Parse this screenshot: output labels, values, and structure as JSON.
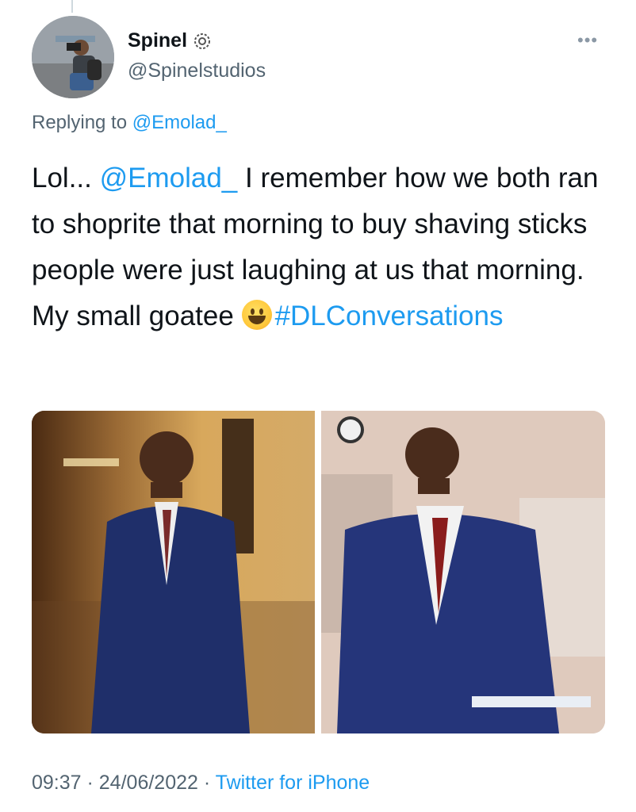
{
  "user": {
    "name": "Spinel",
    "handle": "@Spinelstudios"
  },
  "more_label": "•••",
  "reply": {
    "prefix": "Replying to",
    "target": "@Emolad_"
  },
  "tweet": {
    "part1": "Lol... ",
    "mention": "@Emolad_",
    "part2": "  I remember how we both ran to shoprite that morning to buy shaving sticks people were just laughing at us that morning. My small goatee ",
    "emoji": "grinning-face",
    "hashtag": "#DLConversations"
  },
  "meta": {
    "time": "09:37",
    "sep1": " · ",
    "date": "24/06/2022",
    "sep2": " · ",
    "source": "Twitter for iPhone"
  },
  "colors": {
    "link": "#1d9bf0",
    "secondary_text": "#536471",
    "primary_text": "#0f1419"
  }
}
